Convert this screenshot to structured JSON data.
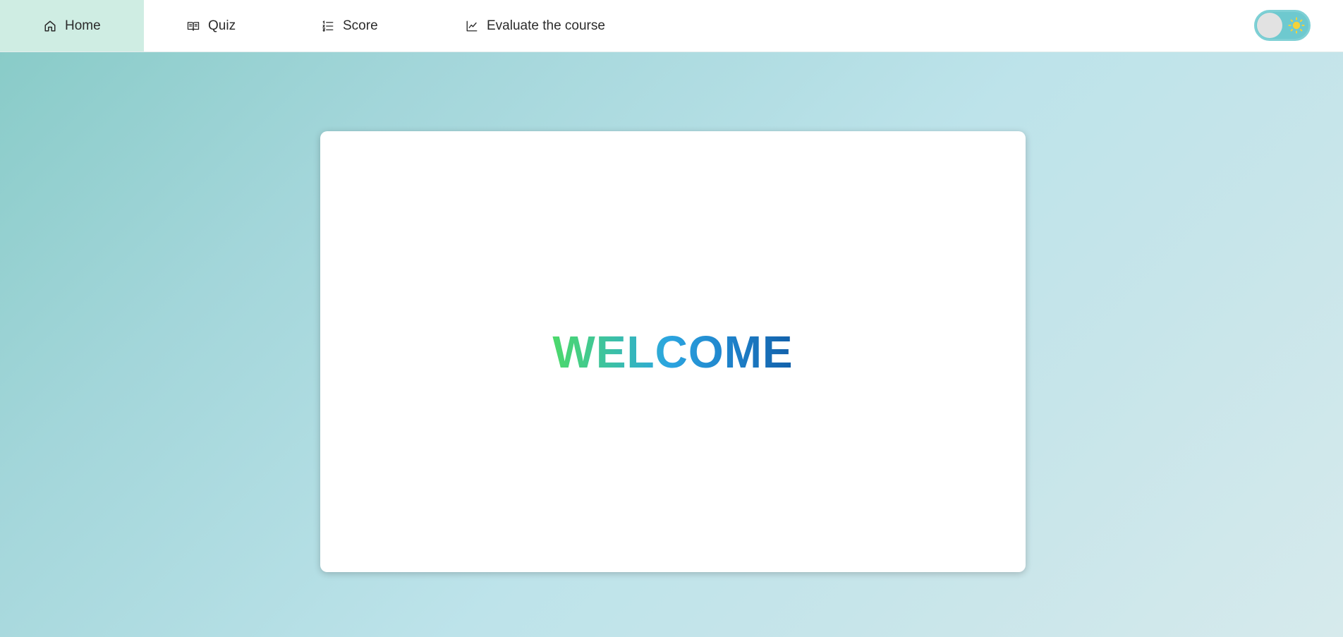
{
  "nav": {
    "items": [
      {
        "label": "Home",
        "icon": "home-icon",
        "active": true
      },
      {
        "label": "Quiz",
        "icon": "book-icon",
        "active": false
      },
      {
        "label": "Score",
        "icon": "list-icon",
        "active": false
      },
      {
        "label": "Evaluate the course",
        "icon": "chart-line-icon",
        "active": false
      }
    ]
  },
  "theme_toggle": {
    "mode": "light",
    "icon": "sun-icon",
    "track_color": "#6ec9cf",
    "sun_color": "#f5d238"
  },
  "main": {
    "welcome_text": "WELCOME",
    "gradient_colors": [
      "#4cd96a",
      "#2ba5e0",
      "#1260aa"
    ]
  },
  "colors": {
    "active_nav_bg": "#cfede3",
    "background_start": "#86cac6",
    "background_end": "#d6eaec"
  }
}
